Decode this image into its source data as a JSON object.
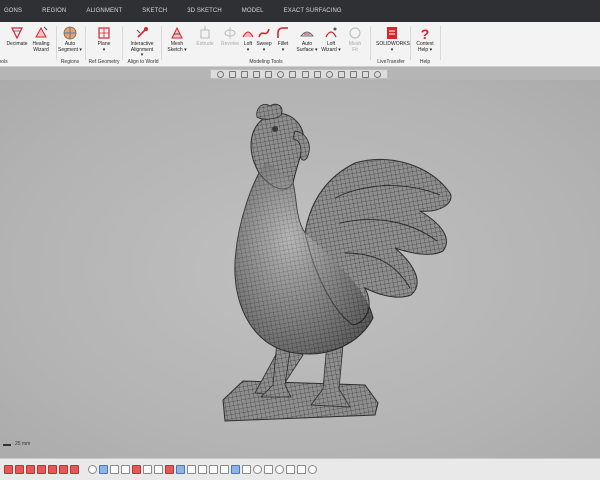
{
  "tabs": [
    "GONS",
    "REGION",
    "ALIGNMENT",
    "SKETCH",
    "3D SKETCH",
    "MODEL",
    "EXACT SURFACING"
  ],
  "ribbon": {
    "buttons": [
      {
        "id": "decimate",
        "label": "Decimate",
        "disabled": false
      },
      {
        "id": "healing",
        "label": "Healing\nWizard",
        "disabled": false
      },
      {
        "id": "auto-segment",
        "label": "Auto\nSegment ▾",
        "disabled": false
      },
      {
        "id": "plane",
        "label": "Plane\n▾",
        "disabled": false
      },
      {
        "id": "interactive-alignment",
        "label": "Interactive\nAlignment ▾",
        "disabled": false
      },
      {
        "id": "mesh-sketch",
        "label": "Mesh\nSketch ▾",
        "disabled": false
      },
      {
        "id": "extrude",
        "label": "Extrude",
        "disabled": true
      },
      {
        "id": "revolve",
        "label": "Revolve",
        "disabled": true
      },
      {
        "id": "loft",
        "label": "Loft\n▾",
        "disabled": false
      },
      {
        "id": "sweep",
        "label": "Sweep\n▾",
        "disabled": false
      },
      {
        "id": "fillet",
        "label": "Fillet\n▾",
        "disabled": false
      },
      {
        "id": "auto-surface",
        "label": "Auto\nSurface ▾",
        "disabled": false
      },
      {
        "id": "loft-wizard",
        "label": "Loft\nWizard ▾",
        "disabled": false
      },
      {
        "id": "mesh-fit",
        "label": "Mesh\nFit",
        "disabled": true
      },
      {
        "id": "solidworks",
        "label": "SOLIDWORKS\n▾",
        "disabled": false
      },
      {
        "id": "context-help",
        "label": "Context\nHelp ▾",
        "disabled": false
      }
    ],
    "groups": [
      "ools",
      "Regions",
      "Ref.Geometry",
      "Align to World",
      "Modeling Tools",
      "LiveTransfer",
      "Help"
    ]
  },
  "scale_label": "25 mm",
  "colors": {
    "accent": "#d9232d",
    "tab_bg": "#2f3033",
    "viewport_bg": "#b5b5b5",
    "model": "#8e8e8e"
  }
}
